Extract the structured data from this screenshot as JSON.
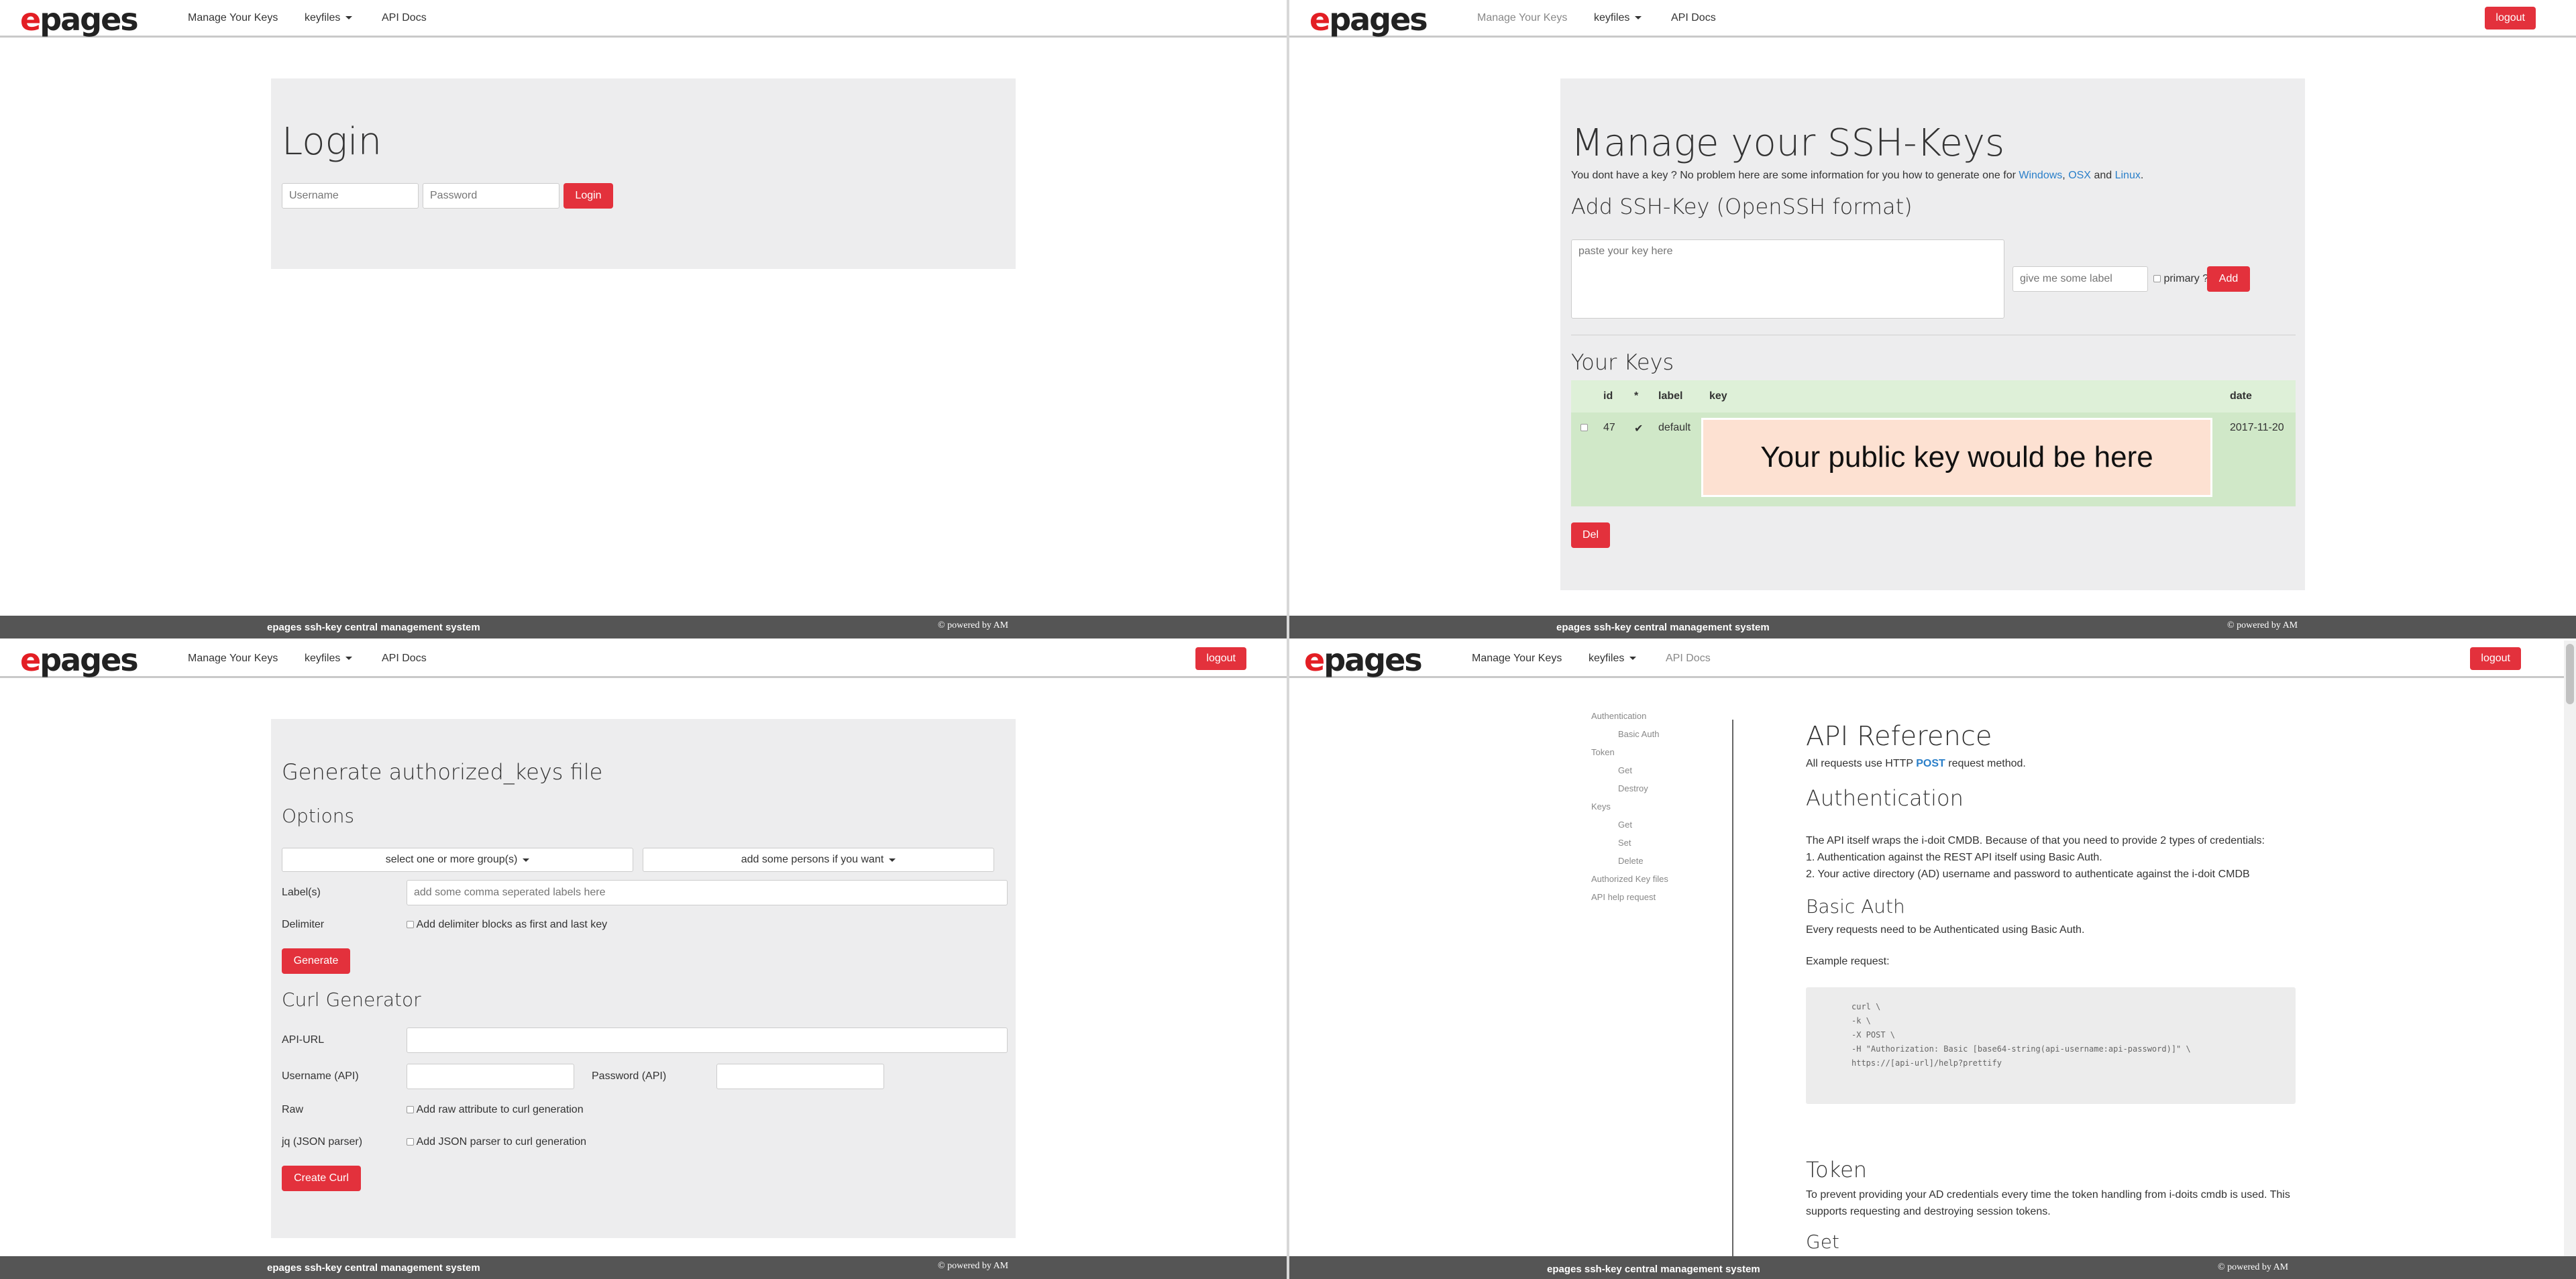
{
  "brand": {
    "logo_e": "e",
    "logo_rest": "pages"
  },
  "nav": {
    "manage": "Manage Your Keys",
    "keyfiles": "keyfiles",
    "api_docs": "API Docs",
    "logout": "logout"
  },
  "footer": {
    "title": "epages ssh-key central management system",
    "powered": "© powered by AM"
  },
  "login": {
    "title": "Login",
    "username_placeholder": "Username",
    "password_placeholder": "Password",
    "button": "Login"
  },
  "manage": {
    "title": "Manage your SSH-Keys",
    "intro": "You dont have a key ? No problem here are some information for you how to generate one for",
    "link_windows": "Windows",
    "link_osx": "OSX",
    "link_linux": "Linux",
    "sep_comma": ",",
    "sep_and": "and",
    "period": ".",
    "add_title": "Add SSH-Key (OpenSSH format)",
    "key_placeholder": "paste your key here",
    "label_placeholder": "give me some label",
    "primary_label": "primary ?",
    "add_button": "Add",
    "your_keys_title": "Your Keys",
    "table": {
      "headers": [
        "id",
        "*",
        "label",
        "key",
        "date"
      ],
      "row": {
        "id": "47",
        "primary": "✔",
        "label": "default",
        "key": "Your public key would be here",
        "date": "2017-11-20"
      }
    },
    "del_button": "Del"
  },
  "generate": {
    "title": "Generate authorized_keys file",
    "options_title": "Options",
    "groups_dd": "select one or more group(s)",
    "persons_dd": "add some persons if you want",
    "labels_label": "Label(s)",
    "labels_placeholder": "add some comma seperated labels here",
    "delimiter_label": "Delimiter",
    "delimiter_check": "Add delimiter blocks as first and last key",
    "generate_button": "Generate",
    "curl_title": "Curl Generator",
    "api_url_label": "API-URL",
    "username_api_label": "Username (API)",
    "password_api_label": "Password (API)",
    "raw_label": "Raw",
    "raw_check": "Add raw attribute to curl generation",
    "jq_label": "jq (JSON parser)",
    "jq_check": "Add JSON parser to curl generation",
    "create_curl_button": "Create Curl"
  },
  "api": {
    "sidenav": [
      "Authentication",
      "Basic Auth",
      "Token",
      "Get",
      "Destroy",
      "Keys",
      "Get",
      "Set",
      "Delete",
      "Authorized Key files",
      "API help request"
    ],
    "title": "API Reference",
    "intro_pre": "All requests use HTTP",
    "intro_method": "POST",
    "intro_post": "request method.",
    "auth_title": "Authentication",
    "auth_p1": "The API itself wraps the i-doit CMDB. Because of that you need to provide 2 types of credentials:",
    "auth_p2": "1. Authentication against the REST API itself using Basic Auth.",
    "auth_p3": "2. Your active directory (AD) username and password to authenticate against the i-doit CMDB",
    "basic_title": "Basic Auth",
    "basic_p1": "Every requests need to be Authenticated using Basic Auth.",
    "basic_p2": "Example request:",
    "code": [
      "curl \\",
      "-k \\",
      "-X POST \\",
      "-H \"Authorization: Basic [base64-string(api-username:api-password)]\" \\",
      "https://[api-url]/help?prettify"
    ],
    "token_title": "Token",
    "token_p1": "To prevent providing your AD credentials every time the token handling from i-doits cmdb is used. This",
    "token_p2": "supports requesting and destroying session tokens.",
    "get_title": "Get"
  },
  "colors": {
    "accent": "#e3313c",
    "footer": "#555555",
    "panel": "#ededee",
    "link": "#2a7fc9"
  }
}
